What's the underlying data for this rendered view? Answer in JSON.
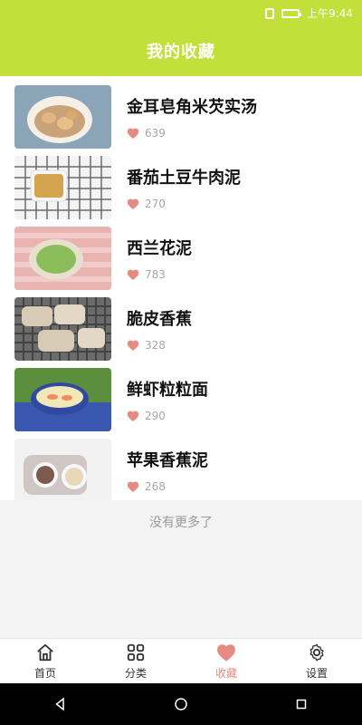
{
  "status_bar": {
    "time": "上午9:44"
  },
  "header": {
    "title": "我的收藏"
  },
  "list": {
    "items": [
      {
        "name": "金耳皂角米芡实汤",
        "likes": "639",
        "thumb_color": "#c9a27a"
      },
      {
        "name": "番茄土豆牛肉泥",
        "likes": "270",
        "thumb_color": "#d4a34d"
      },
      {
        "name": "西兰花泥",
        "likes": "783",
        "thumb_color": "#8bbd5a"
      },
      {
        "name": "脆皮香蕉",
        "likes": "328",
        "thumb_color": "#d8cbb6"
      },
      {
        "name": "鲜虾粒粒面",
        "likes": "290",
        "thumb_color": "#3a58b0"
      },
      {
        "name": "苹果香蕉泥",
        "likes": "268",
        "thumb_color": "#cfc7c5"
      }
    ]
  },
  "footer_text": "没有更多了",
  "tabbar": {
    "tabs": [
      {
        "label": "首页",
        "icon": "home-icon"
      },
      {
        "label": "分类",
        "icon": "category-icon"
      },
      {
        "label": "收藏",
        "icon": "heart-icon",
        "active": true
      },
      {
        "label": "设置",
        "icon": "settings-icon"
      }
    ]
  },
  "colors": {
    "accent": "#c2df3a",
    "heart": "#e58b81",
    "tab_active": "#e58b81"
  }
}
